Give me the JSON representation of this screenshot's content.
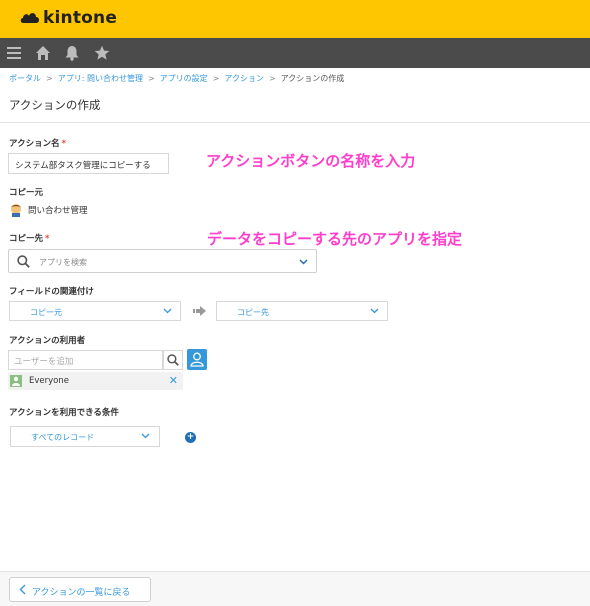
{
  "app": {
    "logo_text": "kintone",
    "brand_color": "#fdc600"
  },
  "nav": {
    "icons": [
      "menu-icon",
      "home-icon",
      "bell-icon",
      "star-icon"
    ]
  },
  "breadcrumb": [
    "ポータル",
    "アプリ: 問い合わせ管理",
    "アプリの設定",
    "アクション",
    "アクションの作成"
  ],
  "page": {
    "title": "アクションの作成"
  },
  "form": {
    "action_name_label": "アクション名",
    "required_mark": "*",
    "action_name_value": "システム部タスク管理にコピーする",
    "copy_source_label": "コピー元",
    "copy_source_app": "問い合わせ管理",
    "copy_target_label": "コピー先",
    "app_search_placeholder": "アプリを検索",
    "field_mapping_label": "フィールドの関連付け",
    "mapping_from": "コピー元",
    "mapping_to": "コピー先",
    "users_label": "アクションの利用者",
    "users_placeholder": "ユーザーを追加",
    "users_entry": "Everyone",
    "remove_mark": "✕",
    "conditions_label": "アクションを利用できる条件",
    "conditions_value": "すべてのレコード",
    "add_mark": "+"
  },
  "annotations": {
    "a1": "アクションボタンの名称を入力",
    "a2": "データをコピーする先のアプリを指定"
  },
  "footer": {
    "back_label": "アクションの一覧に戻る"
  }
}
